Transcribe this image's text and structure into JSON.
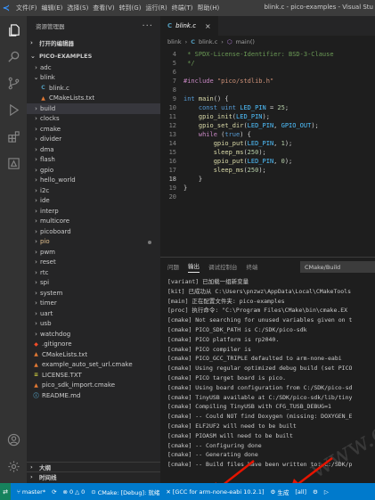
{
  "titlebar": {
    "menu": [
      "文件(F)",
      "编辑(E)",
      "选择(S)",
      "查看(V)",
      "转到(G)",
      "运行(R)",
      "终端(T)",
      "帮助(H)"
    ],
    "window_title": "blink.c - pico-examples - Visual Stu"
  },
  "activity_icons": [
    "files-icon",
    "search-icon",
    "source-control-icon",
    "run-debug-icon",
    "extensions-icon",
    "cmake-icon",
    "account-icon",
    "settings-icon"
  ],
  "sidebar": {
    "header": "资源管理器",
    "more": "···",
    "open_editors": "打开的编辑器",
    "project": "PICO-EXAMPLES",
    "tree": [
      {
        "label": "adc",
        "type": "folder",
        "depth": 1,
        "expanded": false
      },
      {
        "label": "blink",
        "type": "folder",
        "depth": 1,
        "expanded": true
      },
      {
        "label": "blink.c",
        "type": "c",
        "depth": 2
      },
      {
        "label": "CMakeLists.txt",
        "type": "cmake",
        "depth": 2
      },
      {
        "label": "build",
        "type": "folder",
        "depth": 1,
        "expanded": false,
        "selected": true
      },
      {
        "label": "clocks",
        "type": "folder",
        "depth": 1,
        "expanded": false
      },
      {
        "label": "cmake",
        "type": "folder",
        "depth": 1,
        "expanded": false
      },
      {
        "label": "divider",
        "type": "folder",
        "depth": 1,
        "expanded": false
      },
      {
        "label": "dma",
        "type": "folder",
        "depth": 1,
        "expanded": false
      },
      {
        "label": "flash",
        "type": "folder",
        "depth": 1,
        "expanded": false
      },
      {
        "label": "gpio",
        "type": "folder",
        "depth": 1,
        "expanded": false
      },
      {
        "label": "hello_world",
        "type": "folder",
        "depth": 1,
        "expanded": false
      },
      {
        "label": "i2c",
        "type": "folder",
        "depth": 1,
        "expanded": false
      },
      {
        "label": "ide",
        "type": "folder",
        "depth": 1,
        "expanded": false
      },
      {
        "label": "interp",
        "type": "folder",
        "depth": 1,
        "expanded": false
      },
      {
        "label": "multicore",
        "type": "folder",
        "depth": 1,
        "expanded": false
      },
      {
        "label": "picoboard",
        "type": "folder",
        "depth": 1,
        "expanded": false
      },
      {
        "label": "pio",
        "type": "folder",
        "depth": 1,
        "expanded": false,
        "modified": true
      },
      {
        "label": "pwm",
        "type": "folder",
        "depth": 1,
        "expanded": false
      },
      {
        "label": "reset",
        "type": "folder",
        "depth": 1,
        "expanded": false
      },
      {
        "label": "rtc",
        "type": "folder",
        "depth": 1,
        "expanded": false
      },
      {
        "label": "spi",
        "type": "folder",
        "depth": 1,
        "expanded": false
      },
      {
        "label": "system",
        "type": "folder",
        "depth": 1,
        "expanded": false
      },
      {
        "label": "timer",
        "type": "folder",
        "depth": 1,
        "expanded": false
      },
      {
        "label": "uart",
        "type": "folder",
        "depth": 1,
        "expanded": false
      },
      {
        "label": "usb",
        "type": "folder",
        "depth": 1,
        "expanded": false
      },
      {
        "label": "watchdog",
        "type": "folder",
        "depth": 1,
        "expanded": false
      },
      {
        "label": ".gitignore",
        "type": "git",
        "depth": 1
      },
      {
        "label": "CMakeLists.txt",
        "type": "cmake",
        "depth": 1
      },
      {
        "label": "example_auto_set_url.cmake",
        "type": "cmake",
        "depth": 1
      },
      {
        "label": "LICENSE.TXT",
        "type": "license",
        "depth": 1
      },
      {
        "label": "pico_sdk_import.cmake",
        "type": "cmake",
        "depth": 1
      },
      {
        "label": "README.md",
        "type": "info",
        "depth": 1
      }
    ],
    "outline": "大纲",
    "timeline": "时间线"
  },
  "editor": {
    "tab_label": "blink.c",
    "breadcrumb": [
      "blink",
      "blink.c",
      "main()"
    ],
    "lines": [
      {
        "n": "4",
        "html": "<span class=\"t-comment\"> * SPDX-License-Identifier: BSD-3-Clause</span>"
      },
      {
        "n": "5",
        "html": "<span class=\"t-comment\"> */</span>"
      },
      {
        "n": "6",
        "html": ""
      },
      {
        "n": "7",
        "html": "<span class=\"t-pp\">#include</span> <span class=\"t-str\">\"pico/stdlib.h\"</span>"
      },
      {
        "n": "8",
        "html": ""
      },
      {
        "n": "9",
        "html": "<span class=\"t-type\">int</span> <span class=\"t-fn\">main</span><span class=\"t-plain\">() {</span>"
      },
      {
        "n": "10",
        "html": "    <span class=\"t-kw\">const</span> <span class=\"t-type\">uint</span> <span class=\"t-const\">LED_PIN</span> <span class=\"t-plain\">=</span> <span class=\"t-num\">25</span><span class=\"t-plain\">;</span>"
      },
      {
        "n": "11",
        "html": "    <span class=\"t-fn\">gpio_init</span><span class=\"t-plain\">(</span><span class=\"t-const\">LED_PIN</span><span class=\"t-plain\">);</span>"
      },
      {
        "n": "12",
        "html": "    <span class=\"t-fn\">gpio_set_dir</span><span class=\"t-plain\">(</span><span class=\"t-const\">LED_PIN</span><span class=\"t-plain\">,</span> <span class=\"t-const\">GPIO_OUT</span><span class=\"t-plain\">);</span>"
      },
      {
        "n": "13",
        "html": "    <span class=\"t-ctrl\">while</span> <span class=\"t-plain\">(</span><span class=\"t-kw\">true</span><span class=\"t-plain\">) {</span>"
      },
      {
        "n": "14",
        "html": "        <span class=\"t-fn\">gpio_put</span><span class=\"t-plain\">(</span><span class=\"t-const\">LED_PIN</span><span class=\"t-plain\">,</span> <span class=\"t-num\">1</span><span class=\"t-plain\">);</span>"
      },
      {
        "n": "15",
        "html": "        <span class=\"t-fn\">sleep_ms</span><span class=\"t-plain\">(</span><span class=\"t-num\">250</span><span class=\"t-plain\">);</span>"
      },
      {
        "n": "16",
        "html": "        <span class=\"t-fn\">gpio_put</span><span class=\"t-plain\">(</span><span class=\"t-const\">LED_PIN</span><span class=\"t-plain\">,</span> <span class=\"t-num\">0</span><span class=\"t-plain\">);</span>"
      },
      {
        "n": "17",
        "html": "        <span class=\"t-fn\">sleep_ms</span><span class=\"t-plain\">(</span><span class=\"t-num\">250</span><span class=\"t-plain\">);</span>"
      },
      {
        "n": "18",
        "html": "    <span class=\"t-plain\">}</span>",
        "active": true
      },
      {
        "n": "19",
        "html": "<span class=\"t-plain\">}</span>"
      },
      {
        "n": "20",
        "html": ""
      }
    ]
  },
  "panel": {
    "tabs": [
      "问题",
      "输出",
      "调试控制台",
      "终端"
    ],
    "active_tab": 1,
    "channel": "CMake/Build",
    "output": [
      "[variant] 已加载一组新变量",
      "[kit] 已成功从 C:\\Users\\pnzwz\\AppData\\Local\\CMakeTools",
      "[main] 正在配置文件夹: pico-examples",
      "[proc] 执行命令: \"C:\\Program Files\\CMake\\bin\\cmake.EX",
      "[cmake] Not searching for unused variables given on t",
      "[cmake] PICO_SDK_PATH is C:/SDK/pico-sdk",
      "[cmake] PICO platform is rp2040.",
      "[cmake] PICO compiler is",
      "[cmake] PICO_GCC_TRIPLE defaulted to arm-none-eabi",
      "[cmake] Using regular optimized debug build (set PICO",
      "[cmake] PICO target board is pico.",
      "[cmake] Using board configuration from C:/SDK/pico-sd",
      "[cmake] TinyUSB available at C:/SDK/pico-sdk/lib/tiny",
      "[cmake] Compiling TinyUSB with CFG_TUSB_DEBUG=1",
      "[cmake] -- Could NOT find Doxygen (missing: DOXYGEN_E",
      "[cmake] ELF2UF2 will need to be built",
      "[cmake] PIOASM will need to be built",
      "[cmake] -- Configuring done",
      "[cmake] -- Generating done",
      "[cmake] -- Build files have been written to: C:/SDK/p"
    ],
    "watermark": "www.cdle."
  },
  "statusbar": {
    "remote": "⇄",
    "branch": "master*",
    "sync": "⟳",
    "errors": "0",
    "warnings": "0",
    "cmake_status": "CMake: [Debug]: 就绪",
    "kit": "[GCC for arm-none-eabi 10.2.1]",
    "build": "生成",
    "target": "[all]",
    "debug": "⚙",
    "run": "▷"
  },
  "colors": {
    "accent": "#007acc",
    "annotation_arrow": "#e51400"
  }
}
